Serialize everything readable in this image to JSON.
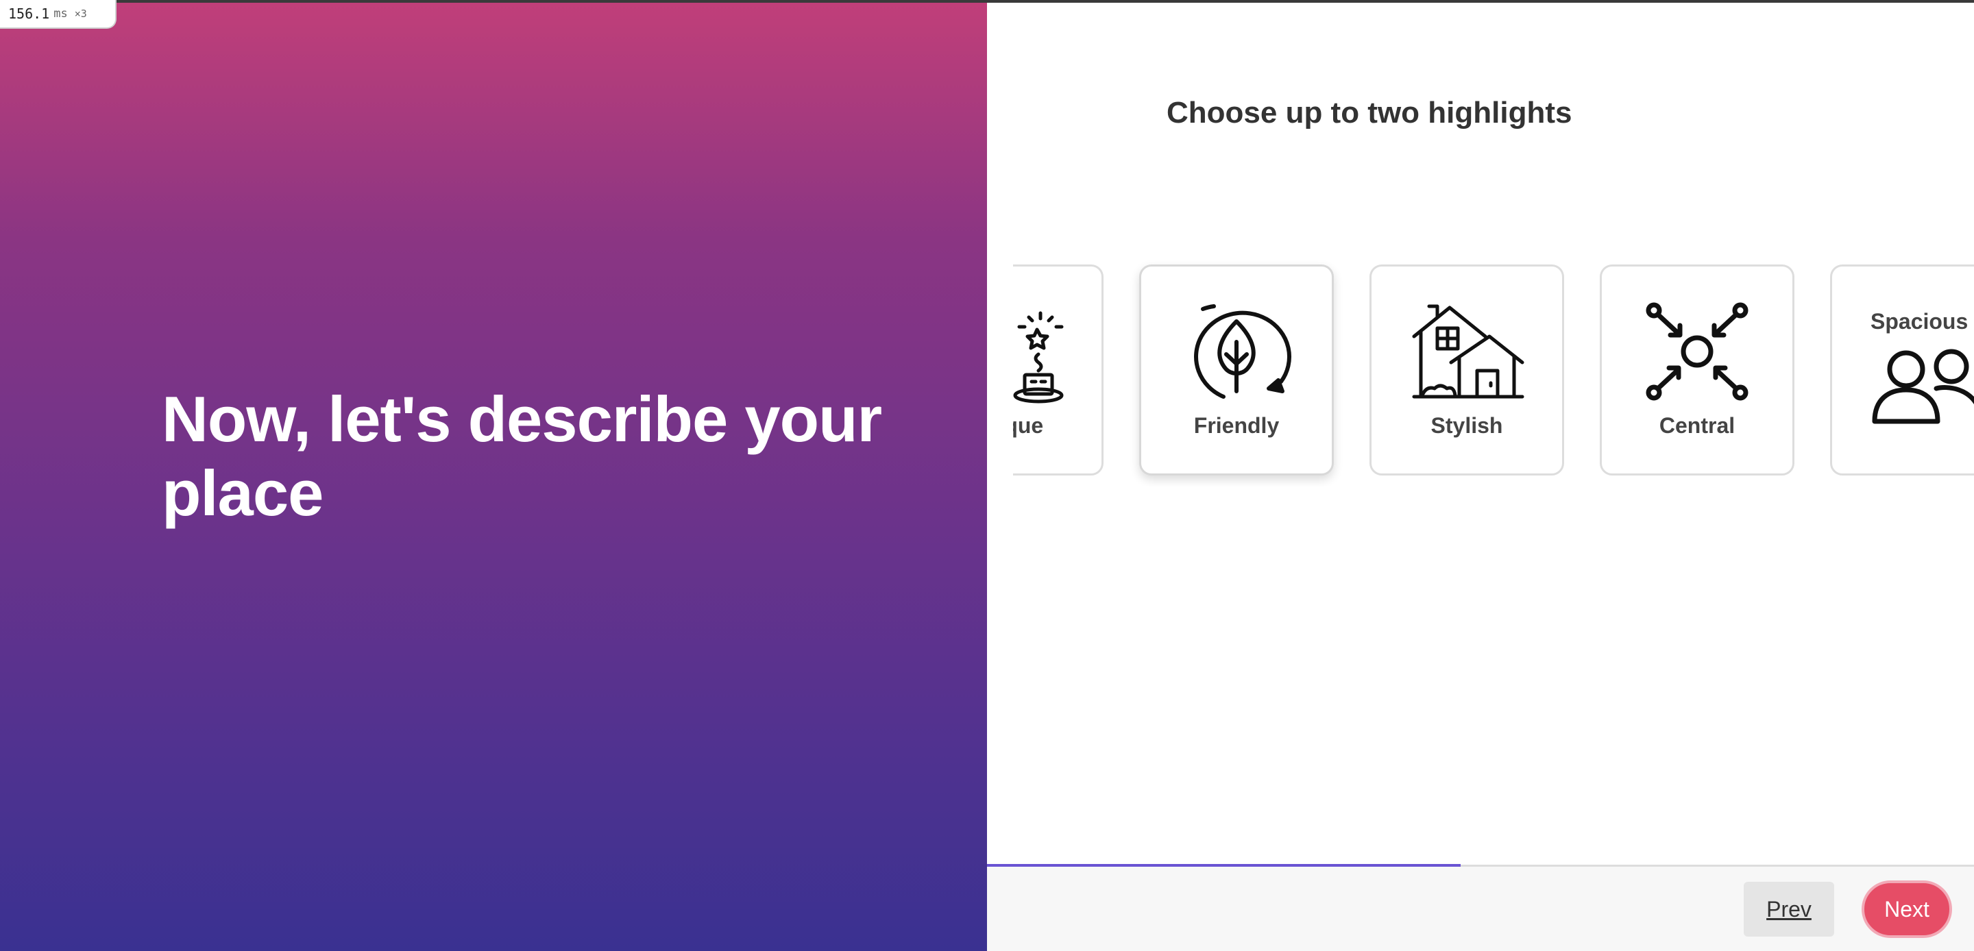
{
  "perf": {
    "value": "156.1",
    "unit": "ms",
    "multiplier": "×3"
  },
  "intro": {
    "title": "Now, let's describe your place"
  },
  "highlights": {
    "title": "Choose up to two highlights",
    "options": [
      {
        "label": "Unique",
        "icon": "unique-icon"
      },
      {
        "label": "Friendly",
        "icon": "leaf-icon"
      },
      {
        "label": "Stylish",
        "icon": "house-icon"
      },
      {
        "label": "Central",
        "icon": "central-icon"
      },
      {
        "label": "Spacious",
        "icon": "people-icon"
      }
    ]
  },
  "progress": {
    "percent": 48
  },
  "footer": {
    "prev_label": "Prev",
    "next_label": "Next"
  },
  "colors": {
    "gradient_top": "#c13f79",
    "gradient_bottom": "#3a3191",
    "progress": "#6a54d3",
    "next_button": "#e64d66"
  }
}
